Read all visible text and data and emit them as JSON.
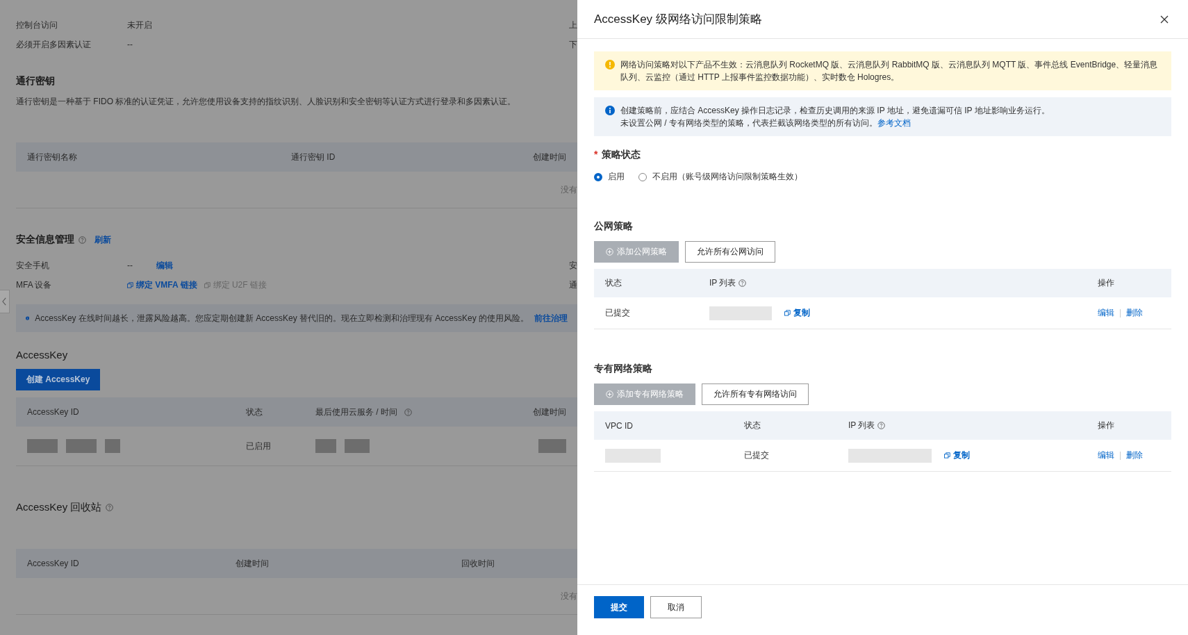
{
  "background_page": {
    "info_rows": [
      {
        "label": "控制台访问",
        "value": "未开启",
        "edge": "上"
      },
      {
        "label": "必须开启多因素认证",
        "value": "--",
        "edge": "下"
      }
    ],
    "passkey": {
      "title": "通行密钥",
      "description": "通行密钥是一种基于 FIDO 标准的认证凭证，允许您使用设备支持的指纹识别、人脸识别和安全密钥等认证方式进行登录和多因素认证。",
      "columns": [
        "通行密钥名称",
        "通行密钥 ID",
        "创建时间"
      ],
      "empty_text": "没有"
    },
    "security": {
      "title": "安全信息管理",
      "refresh": "刷新",
      "phone": {
        "label": "安全手机",
        "value": "--",
        "action": "编辑",
        "edge": "安"
      },
      "mfa": {
        "label": "MFA 设备",
        "links": [
          {
            "text": "绑定 VMFA 链接",
            "disabled": false
          },
          {
            "text": "绑定 U2F 链接",
            "disabled": true
          }
        ],
        "edge": "通"
      }
    },
    "notice": {
      "text": "AccessKey 在线时间越长，泄露风险越高。您应定期创建新 AccessKey 替代旧的。现在立即检测和治理现有 AccessKey 的使用风险。",
      "link": "前往治理"
    },
    "accesskey": {
      "title": "AccessKey",
      "create_button": "创建 AccessKey",
      "columns": [
        {
          "label": "AccessKey ID",
          "help": false
        },
        {
          "label": "状态",
          "help": false
        },
        {
          "label": "最后使用云服务 / 时间",
          "help": true
        },
        {
          "label": "创建时间",
          "help": false
        }
      ],
      "rows": [
        {
          "status": "已启用"
        }
      ]
    },
    "recycle": {
      "title": "AccessKey 回收站",
      "columns": [
        "AccessKey ID",
        "创建时间",
        "回收时间"
      ],
      "empty_text": "没有"
    }
  },
  "drawer": {
    "title": "AccessKey 级网络访问限制策略",
    "warning": "网络访问策略对以下产品不生效：云消息队列 RocketMQ 版、云消息队列 RabbitMQ 版、云消息队列 MQTT 版、事件总线 EventBridge、轻量消息队列、云监控（通过 HTTP 上报事件监控数据功能）、实时数仓 Hologres。",
    "info": {
      "line1": "创建策略前，应结合 AccessKey 操作日志记录，检查历史调用的来源 IP 地址，避免遗漏可信 IP 地址影响业务运行。",
      "line2": "未设置公网 / 专有网络类型的策略，代表拦截该网络类型的所有访问。",
      "link": "参考文档"
    },
    "status_field": {
      "label": "策略状态",
      "required_mark": "*",
      "options": [
        {
          "label": "启用",
          "selected": true
        },
        {
          "label": "不启用（账号级网络访问限制策略生效）",
          "selected": false
        }
      ]
    },
    "sections": [
      {
        "title": "公网策略",
        "add_button": {
          "label": "添加公网策略",
          "disabled": true
        },
        "allow_button": "允许所有公网访问",
        "columns": [
          {
            "kind": "status",
            "label": "状态",
            "help": false
          },
          {
            "kind": "ip",
            "label": "IP 列表",
            "help": true
          },
          {
            "kind": "actions",
            "label": "操作",
            "help": false
          }
        ],
        "rows": [
          {
            "status": "已提交",
            "copy": "复制",
            "edit": "编辑",
            "delete": "删除"
          }
        ]
      },
      {
        "title": "专有网络策略",
        "add_button": {
          "label": "添加专有网络策略",
          "disabled": true
        },
        "allow_button": "允许所有专有网络访问",
        "columns": [
          {
            "kind": "vpc",
            "label": "VPC ID",
            "help": false
          },
          {
            "kind": "status",
            "label": "状态",
            "help": false
          },
          {
            "kind": "ip",
            "label": "IP 列表",
            "help": true
          },
          {
            "kind": "actions",
            "label": "操作",
            "help": false
          }
        ],
        "rows": [
          {
            "status": "已提交",
            "copy": "复制",
            "edit": "编辑",
            "delete": "删除"
          }
        ]
      }
    ],
    "footer": {
      "submit": "提交",
      "cancel": "取消"
    }
  }
}
